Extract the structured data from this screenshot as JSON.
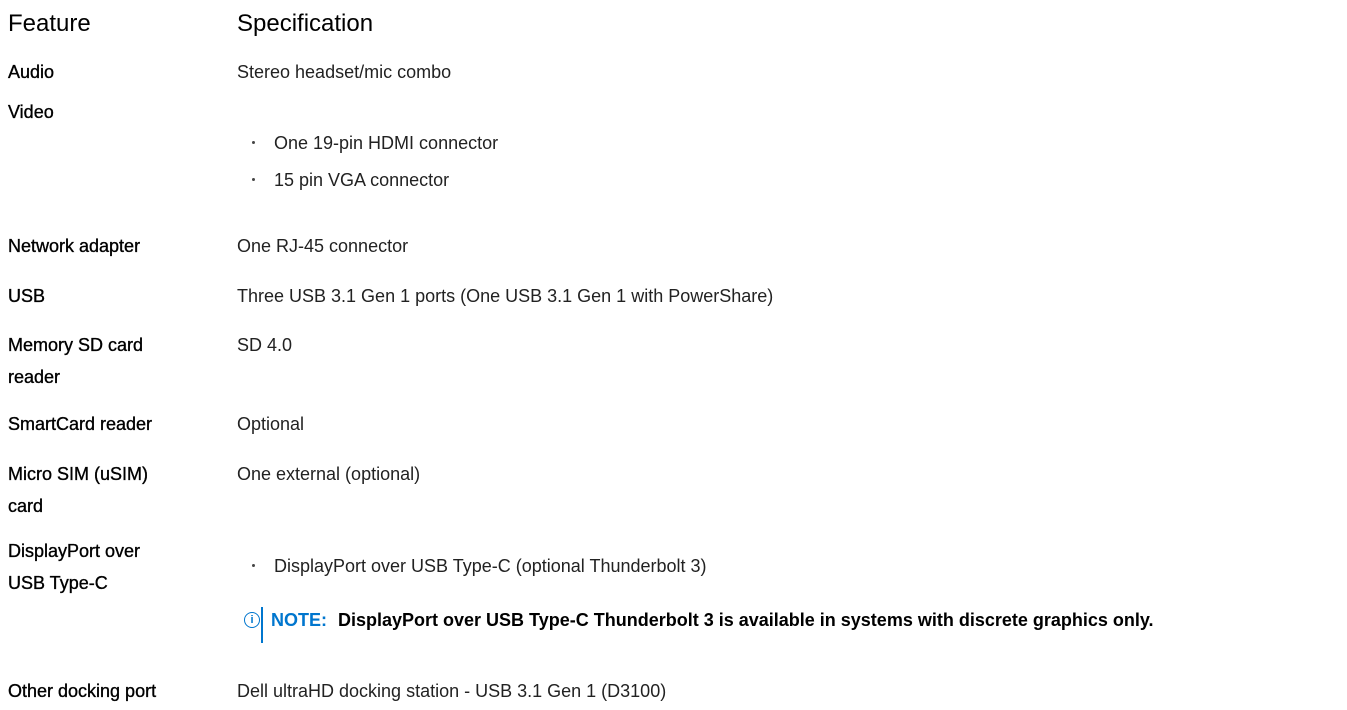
{
  "table": {
    "header": {
      "feature": "Feature",
      "specification": "Specification"
    },
    "rows": [
      {
        "feature": "Audio",
        "spec": "Stereo headset/mic combo"
      },
      {
        "feature": "Video",
        "bullets": [
          "One 19-pin HDMI connector",
          "15 pin VGA connector"
        ]
      },
      {
        "feature": "Network adapter",
        "spec": "One RJ-45 connector"
      },
      {
        "feature": "USB",
        "spec": "Three USB 3.1 Gen 1 ports (One USB 3.1 Gen 1 with PowerShare)"
      },
      {
        "feature_lines": [
          "Memory SD card",
          "reader"
        ],
        "spec": "SD 4.0"
      },
      {
        "feature": "SmartCard reader",
        "spec": "Optional"
      },
      {
        "feature_lines": [
          "Micro SIM (uSIM)",
          "card"
        ],
        "spec": "One external (optional)"
      },
      {
        "feature_lines": [
          "DisplayPort over",
          "USB Type-C"
        ],
        "bullets": [
          "DisplayPort over USB Type-C (optional Thunderbolt 3)"
        ],
        "note": {
          "icon": "info-icon",
          "label": "NOTE:",
          "text": "DisplayPort over USB Type-C Thunderbolt 3 is available in systems with discrete graphics only."
        }
      },
      {
        "feature": "Other docking port",
        "spec": "Dell ultraHD docking station - USB 3.1 Gen 1 (D3100)"
      }
    ]
  },
  "colors": {
    "note_accent": "#0076ce",
    "text": "#000000"
  }
}
